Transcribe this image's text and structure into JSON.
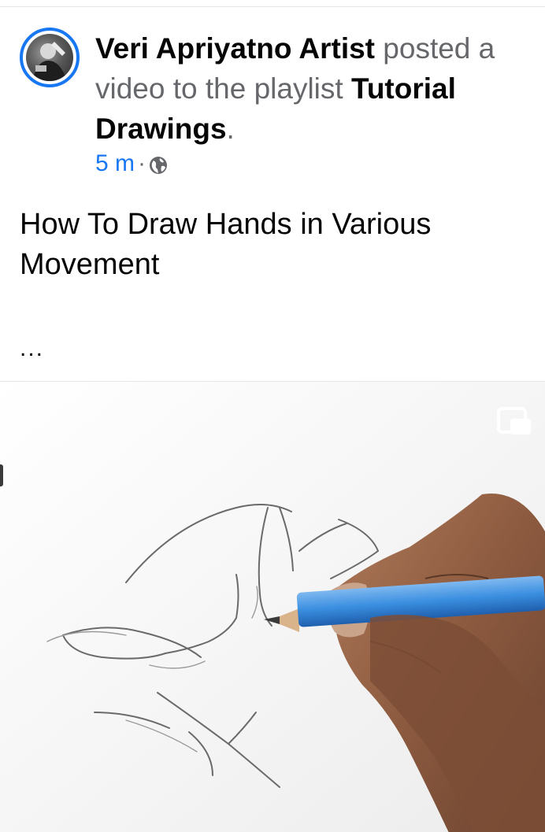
{
  "post": {
    "author": "Veri Apriyatno Artist",
    "action_text": " posted a video to the playlist ",
    "playlist": "Tutorial Drawings",
    "period": ".",
    "timestamp": "5 m",
    "separator": "·",
    "privacy_icon": "globe-icon",
    "body_text": "How To Draw Hands in Various Movement",
    "more_indicator": "..."
  },
  "video": {
    "pip_icon": "picture-in-picture-icon"
  },
  "colors": {
    "accent": "#1877f2",
    "secondary_text": "#65676b",
    "primary_text": "#050505",
    "pencil_blue": "#3b8fe0"
  }
}
